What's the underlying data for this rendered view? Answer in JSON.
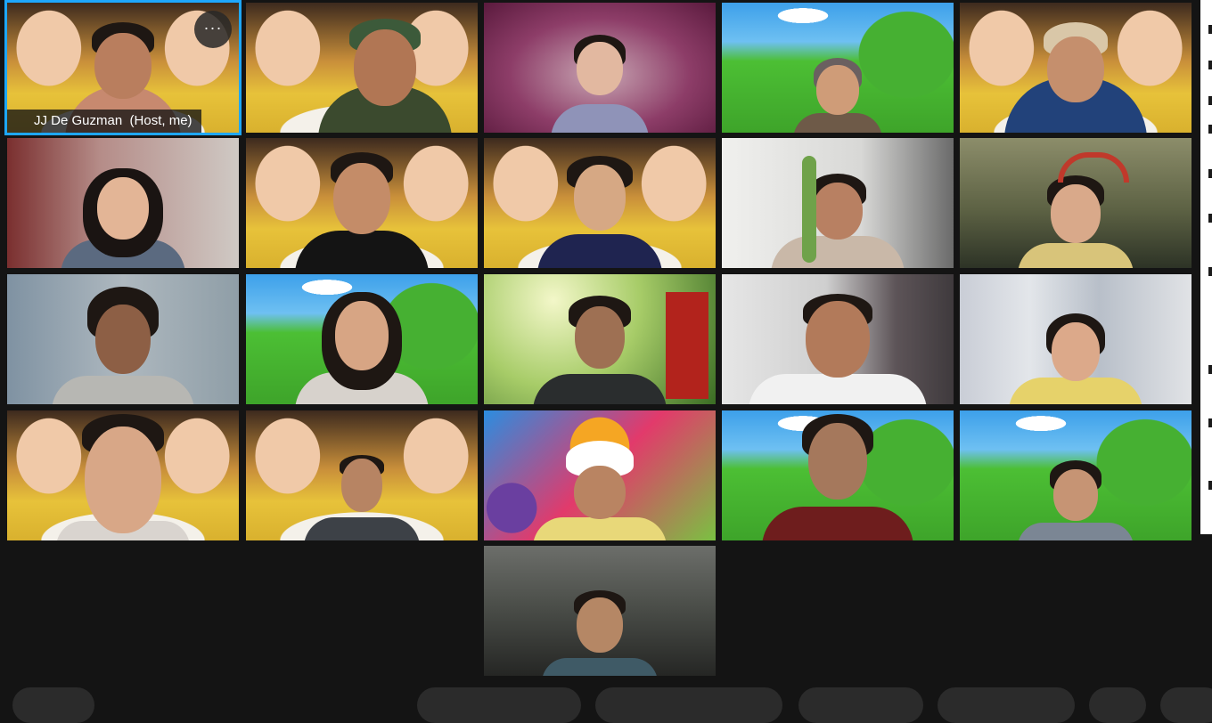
{
  "meeting": {
    "self_tile": {
      "name_label": "JJ De Guzman  (Host, me)",
      "more_button_label": "···"
    },
    "participant_count": 21,
    "tiles": [
      {
        "bg": "kids",
        "active": true
      },
      {
        "bg": "kids"
      },
      {
        "bg": "purple"
      },
      {
        "bg": "field"
      },
      {
        "bg": "kids"
      },
      {
        "bg": "room-red"
      },
      {
        "bg": "kids"
      },
      {
        "bg": "kids"
      },
      {
        "bg": "room-white"
      },
      {
        "bg": "room-green"
      },
      {
        "bg": "room-blue"
      },
      {
        "bg": "field"
      },
      {
        "bg": "forest"
      },
      {
        "bg": "room-grey"
      },
      {
        "bg": "curtain"
      },
      {
        "bg": "kids"
      },
      {
        "bg": "kids"
      },
      {
        "bg": "fruit"
      },
      {
        "bg": "field"
      },
      {
        "bg": "field"
      },
      {
        "bg": "dark-room"
      }
    ]
  },
  "colors": {
    "active_speaker_border": "#1ea7fd",
    "window_background": "#141414",
    "name_bar_background": "rgba(20,20,20,0.78)"
  },
  "icons": {
    "more_options": "more-horizontal-icon"
  }
}
